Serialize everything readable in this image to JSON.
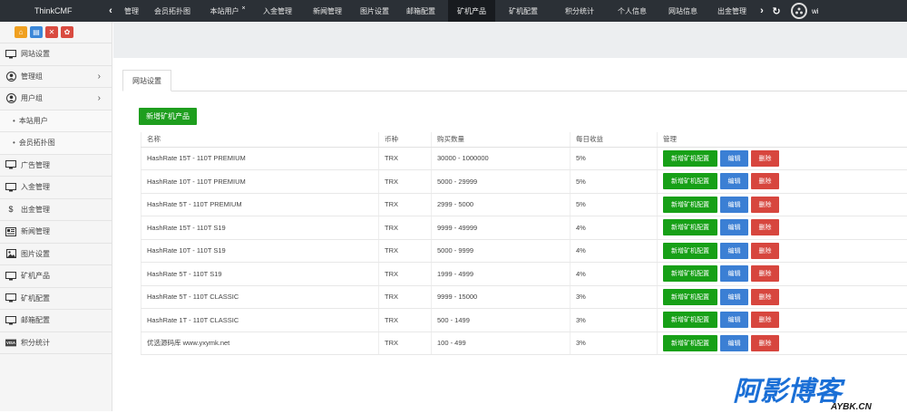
{
  "app": {
    "brand": "ThinkCMF"
  },
  "topnav": {
    "items": [
      {
        "label": "管理"
      },
      {
        "label": "会员拓扑图"
      },
      {
        "label": "本站用户"
      },
      {
        "label": "入金管理"
      },
      {
        "label": "新闻管理"
      },
      {
        "label": "图片设置"
      },
      {
        "label": "邮箱配置"
      },
      {
        "label": "矿机产品"
      },
      {
        "label": "矿机配置"
      },
      {
        "label": "积分统计"
      },
      {
        "label": "个人信息"
      },
      {
        "label": "网站信息"
      },
      {
        "label": "出金管理"
      }
    ],
    "close_glyph": "×",
    "active_index": 7,
    "user_name": "wi"
  },
  "sidebar": {
    "items": [
      {
        "label": "网站设置",
        "icon": "monitor-icon"
      },
      {
        "label": "管理组",
        "icon": "user-circle-icon",
        "chevron": "›"
      },
      {
        "label": "用户组",
        "icon": "user-circle-icon",
        "chevron": "›"
      },
      {
        "label": "本站用户",
        "icon": "bullet"
      },
      {
        "label": "会员拓扑图",
        "icon": "bullet"
      },
      {
        "label": "广告管理",
        "icon": "monitor-icon"
      },
      {
        "label": "入金管理",
        "icon": "monitor-icon"
      },
      {
        "label": "出金管理",
        "icon": "dollar-icon"
      },
      {
        "label": "新闻管理",
        "icon": "news-icon"
      },
      {
        "label": "图片设置",
        "icon": "image-icon"
      },
      {
        "label": "矿机产品",
        "icon": "monitor-icon"
      },
      {
        "label": "矿机配置",
        "icon": "monitor-icon"
      },
      {
        "label": "邮箱配置",
        "icon": "monitor-icon"
      },
      {
        "label": "积分统计",
        "icon": "visa-icon"
      }
    ]
  },
  "main": {
    "tab_label": "网站设置",
    "add_button": "新增矿机产品",
    "columns": [
      "名称",
      "币种",
      "购买数量",
      "每日收益",
      "管理"
    ],
    "rows": [
      {
        "name": "HashRate 15T - 110T PREMIUM",
        "coin": "TRX",
        "qty": "30000 - 1000000",
        "yield": "5%"
      },
      {
        "name": "HashRate 10T - 110T PREMIUM",
        "coin": "TRX",
        "qty": "5000 - 29999",
        "yield": "5%"
      },
      {
        "name": "HashRate 5T - 110T PREMIUM",
        "coin": "TRX",
        "qty": "2999 - 5000",
        "yield": "5%"
      },
      {
        "name": "HashRate 15T - 110T S19",
        "coin": "TRX",
        "qty": "9999 - 49999",
        "yield": "4%"
      },
      {
        "name": "HashRate 10T - 110T S19",
        "coin": "TRX",
        "qty": "5000 - 9999",
        "yield": "4%"
      },
      {
        "name": "HashRate 5T - 110T S19",
        "coin": "TRX",
        "qty": "1999 - 4999",
        "yield": "4%"
      },
      {
        "name": "HashRate 5T - 110T CLASSIC",
        "coin": "TRX",
        "qty": "9999 - 15000",
        "yield": "3%"
      },
      {
        "name": "HashRate 1T - 110T CLASSIC",
        "coin": "TRX",
        "qty": "500 - 1499",
        "yield": "3%"
      },
      {
        "name": "优选源码库 www.yxymk.net",
        "coin": "TRX",
        "qty": "100 - 499",
        "yield": "3%"
      }
    ],
    "actions": {
      "config": "新增矿机配置",
      "edit": "编辑",
      "delete": "删除"
    }
  },
  "watermark": {
    "text": "阿影博客",
    "url": "AYBK.CN"
  },
  "colors": {
    "green": "#17a017",
    "blue": "#3b7fd4",
    "red": "#d7463e",
    "topbar": "#2b3036"
  }
}
